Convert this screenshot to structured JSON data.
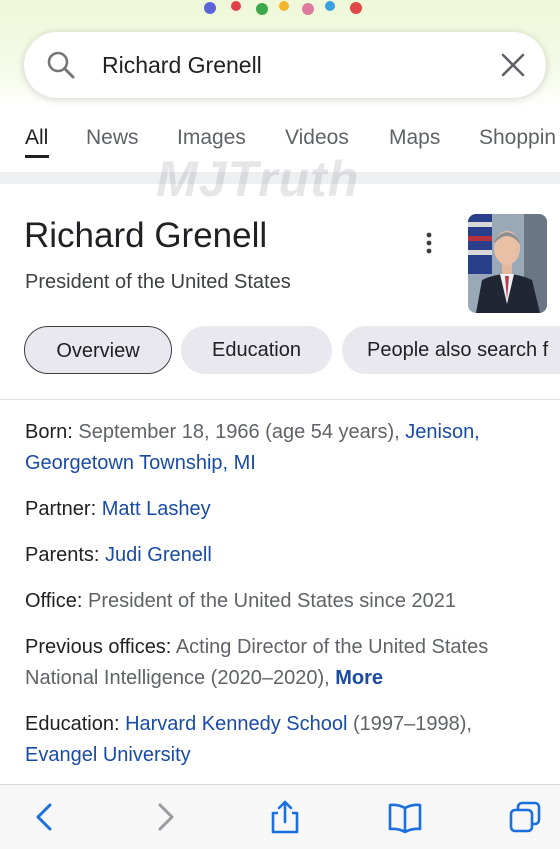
{
  "search": {
    "query": "Richard Grenell"
  },
  "tabs": [
    "All",
    "News",
    "Images",
    "Videos",
    "Maps",
    "Shoppin"
  ],
  "watermark": "MJTruth",
  "knowledge_panel": {
    "title": "Richard Grenell",
    "subtitle": "President of the United States",
    "chips": [
      "Overview",
      "Education",
      "People also search f"
    ],
    "facts": {
      "born": {
        "label": "Born:",
        "value": " September 18, 1966 (age 54 years),",
        "link": "Jenison, Georgetown Township, MI"
      },
      "partner": {
        "label": "Partner:",
        "link": "Matt Lashey"
      },
      "parents": {
        "label": "Parents:",
        "link": "Judi Grenell"
      },
      "office": {
        "label": "Office:",
        "value": " President of the United States since 2021"
      },
      "previous_offices": {
        "label": "Previous offices:",
        "value": " Acting Director of the United States National Intelligence (2020–2020),",
        "more": "More"
      },
      "education": {
        "label": "Education:",
        "link1": "Harvard Kennedy School",
        "value": " (1997–1998),",
        "link2": "Evangel University"
      }
    }
  },
  "bottom_bar": {
    "icons": [
      "back-arrow-icon",
      "forward-arrow-icon",
      "share-icon",
      "bookmarks-icon",
      "tabs-icon"
    ]
  },
  "colors": {
    "link": "#1a4ba5",
    "muted": "#5f6368",
    "text": "#202124"
  }
}
